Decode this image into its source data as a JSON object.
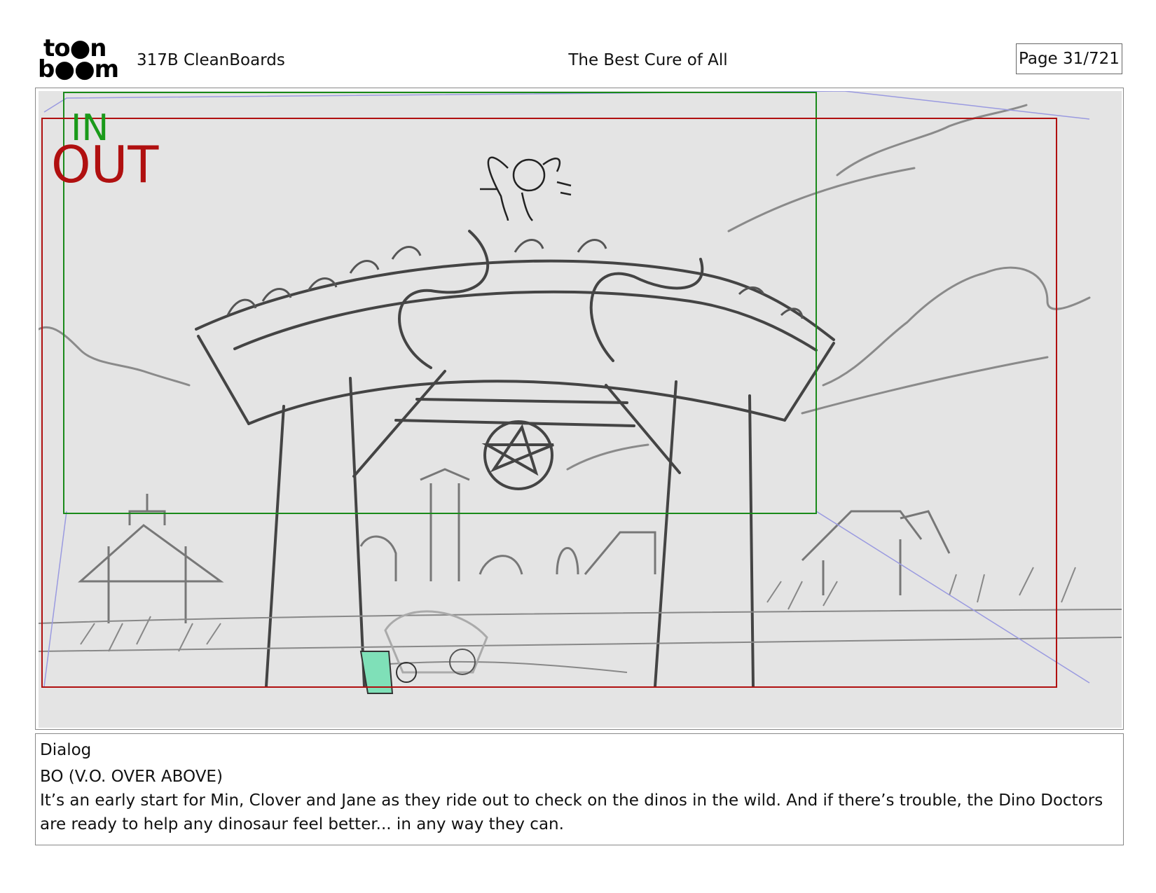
{
  "header": {
    "logo_top": "to●n",
    "logo_bottom": "b●●m",
    "scene": "317B  CleanBoards",
    "title": "The Best Cure of All",
    "page": "Page  31/721"
  },
  "panel": {
    "in_label": "IN",
    "out_label": "OUT",
    "colors": {
      "in_frame": "#1a8a1a",
      "out_frame": "#b01010",
      "background": "#e4e4e4",
      "accent": "#7fe0b8"
    }
  },
  "dialog": {
    "heading": "Dialog",
    "speaker": "BO (V.O. OVER ABOVE)",
    "text": "It’s an early start for Min, Clover and Jane as they ride out to check on the dinos in the wild. And if there’s trouble, the Dino Doctors are ready to help any dinosaur feel better... in any way they can."
  }
}
